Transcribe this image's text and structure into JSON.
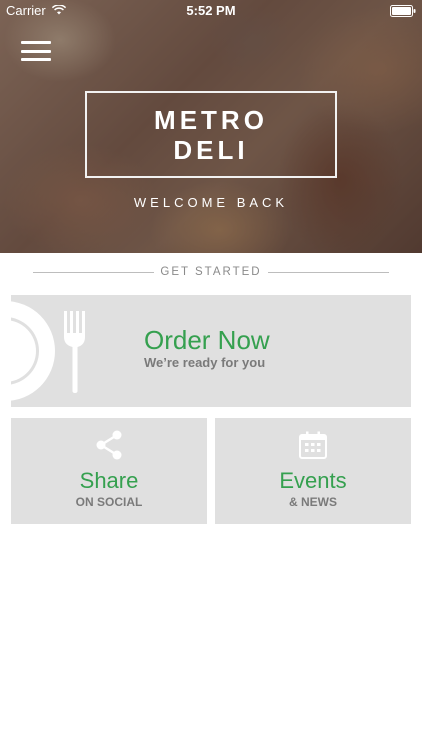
{
  "status_bar": {
    "carrier": "Carrier",
    "time": "5:52 PM"
  },
  "hero": {
    "logo_line1": "METRO",
    "logo_line2": "DELI",
    "welcome": "WELCOME BACK"
  },
  "divider": {
    "label": "GET STARTED"
  },
  "order": {
    "title": "Order Now",
    "subtitle": "We’re ready for you"
  },
  "share": {
    "title": "Share",
    "subtitle": "ON SOCIAL",
    "icon": "share-icon"
  },
  "events": {
    "title": "Events",
    "subtitle": "& NEWS",
    "icon": "calendar-icon"
  },
  "colors": {
    "accent_green": "#35a04f",
    "card_bg": "#e0e0e0",
    "subtext": "#7a7a7a"
  }
}
